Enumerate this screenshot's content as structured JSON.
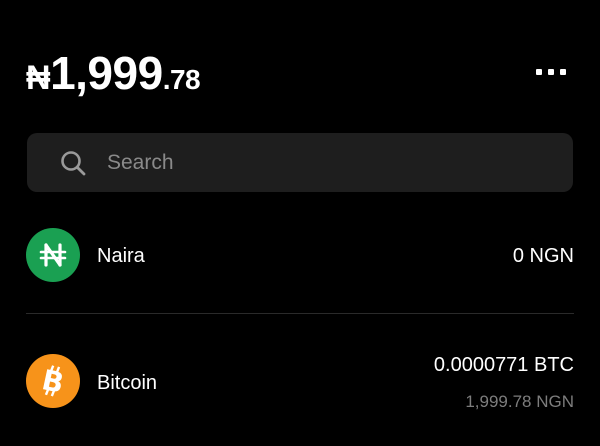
{
  "balance": {
    "currency_symbol": "₦",
    "main": "1,999",
    "decimal": ".78"
  },
  "header": {
    "more_icon": "more-horizontal-icon"
  },
  "search": {
    "placeholder": "Search",
    "value": "",
    "icon": "search-icon"
  },
  "assets": [
    {
      "name": "Naira",
      "symbol": "₦",
      "amount": "0 NGN",
      "fiat": "",
      "color": "#1aa052",
      "icon": "naira-icon"
    },
    {
      "name": "Bitcoin",
      "symbol": "₿",
      "amount": "0.0000771 BTC",
      "fiat": "1,999.78 NGN",
      "color": "#f7931a",
      "icon": "bitcoin-icon"
    }
  ],
  "colors": {
    "background": "#000000",
    "surface": "#1e1e1e",
    "text_primary": "#ffffff",
    "text_secondary": "#7d7d7d",
    "divider": "#2a2a2a"
  }
}
